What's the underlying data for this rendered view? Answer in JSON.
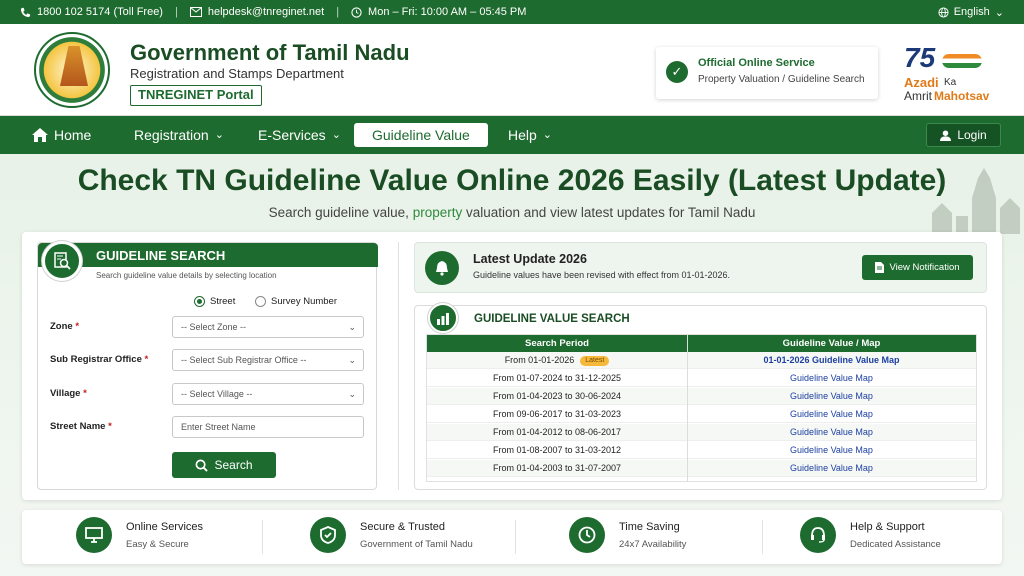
{
  "topbar": {
    "phone": "1800 102 5174 (Toll Free)",
    "email": "helpdesk@tnreginet.net",
    "hours": "Mon – Fri: 10:00 AM – 05:45 PM",
    "language": "English"
  },
  "header": {
    "title": "Government of Tamil Nadu",
    "subtitle": "Registration and Stamps Department",
    "portal": "TNREGINET Portal",
    "service_title": "Official Online Service",
    "service_sub": "Property Valuation / Guideline Search",
    "azadi_num": "75",
    "azadi_word": "Azadi",
    "azadi_ka": "Ka",
    "azadi_amrit": "Amrit",
    "azadi_mahotsav": "Mahotsav",
    "emblem_motto": "TRUTH ALONE TRIUMPHS"
  },
  "nav": {
    "home": "Home",
    "registration": "Registration",
    "eservices": "E-Services",
    "guideline": "Guideline Value",
    "help": "Help",
    "login": "Login"
  },
  "hero": {
    "title": "Check TN Guideline Value Online 2026 Easily (Latest Update)",
    "sub_pre": "Search guideline value,",
    "sub_mid": "property",
    "sub_post": "valuation and view latest updates for Tamil Nadu"
  },
  "search": {
    "title": "GUIDELINE SEARCH",
    "desc": "Search guideline value details by selecting location",
    "radio_street": "Street",
    "radio_survey": "Survey Number",
    "zone_label": "Zone",
    "zone_placeholder": "-- Select Zone --",
    "sro_label": "Sub Registrar Office",
    "sro_placeholder": "-- Select Sub Registrar Office --",
    "village_label": "Village",
    "village_placeholder": "-- Select Village --",
    "street_label": "Street Name",
    "street_placeholder": "Enter Street Name",
    "required": "*",
    "button": "Search"
  },
  "update": {
    "title": "Latest Update 2026",
    "text": "Guideline values have been revised with effect from 01-01-2026.",
    "button": "View Notification"
  },
  "values": {
    "title": "GUIDELINE VALUE SEARCH",
    "col1": "Search Period",
    "col2": "Guideline Value / Map",
    "latest_badge": "Latest",
    "rows": [
      {
        "period": "From 01-01-2026",
        "link": "01-01-2026 Guideline Value Map"
      },
      {
        "period": "From 01-07-2024 to 31-12-2025",
        "link": "Guideline Value Map"
      },
      {
        "period": "From 01-04-2023 to 30-06-2024",
        "link": "Guideline Value Map"
      },
      {
        "period": "From 09-06-2017 to 31-03-2023",
        "link": "Guideline Value Map"
      },
      {
        "period": "From 01-04-2012 to 08-06-2017",
        "link": "Guideline Value Map"
      },
      {
        "period": "From 01-08-2007 to 31-03-2012",
        "link": "Guideline Value Map"
      },
      {
        "period": "From 01-04-2003 to 31-07-2007",
        "link": "Guideline Value Map"
      }
    ]
  },
  "features": [
    {
      "title": "Online Services",
      "sub": "Easy & Secure",
      "icon": "monitor-icon"
    },
    {
      "title": "Secure & Trusted",
      "sub": "Government of Tamil Nadu",
      "icon": "shield-icon"
    },
    {
      "title": "Time Saving",
      "sub": "24x7 Availability",
      "icon": "clock-icon"
    },
    {
      "title": "Help & Support",
      "sub": "Dedicated Assistance",
      "icon": "headset-icon"
    }
  ],
  "colors": {
    "primary": "#1e6b2f",
    "link": "#1c3fa0",
    "badge": "#f6b93b"
  }
}
